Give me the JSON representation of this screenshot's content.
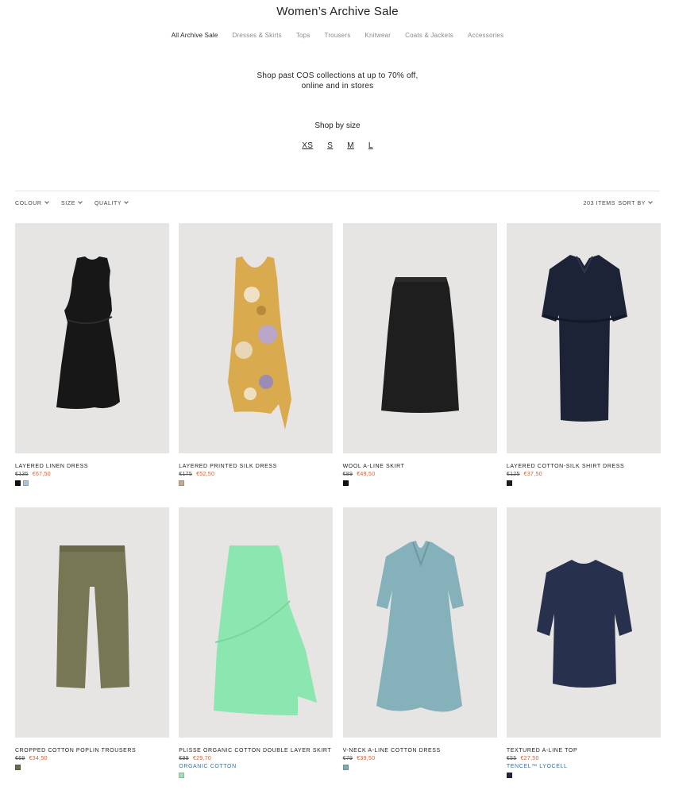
{
  "header": {
    "title": "Women’s Archive Sale"
  },
  "categories": [
    {
      "label": "All Archive Sale",
      "active": true
    },
    {
      "label": "Dresses & Skirts",
      "active": false
    },
    {
      "label": "Tops",
      "active": false
    },
    {
      "label": "Trousers",
      "active": false
    },
    {
      "label": "Knitwear",
      "active": false
    },
    {
      "label": "Coats & Jackets",
      "active": false
    },
    {
      "label": "Accessories",
      "active": false
    }
  ],
  "promo": {
    "line1": "Shop past COS collections at up to 70% off,",
    "line2": "online and in stores"
  },
  "size_section": {
    "heading": "Shop by size",
    "sizes": [
      "XS",
      "S",
      "M",
      "L"
    ]
  },
  "filters": {
    "colour": "COLOUR",
    "size": "SIZE",
    "quality": "QUALITY",
    "items": "203 ITEMS",
    "sort": "SORT BY"
  },
  "products": [
    {
      "name": "LAYERED LINEN DRESS",
      "old_price": "€135",
      "new_price": "€67,50",
      "tag": "",
      "swatches": [
        "#111111",
        "#a9c2dc"
      ],
      "garment": "black-dress"
    },
    {
      "name": "LAYERED PRINTED SILK DRESS",
      "old_price": "€175",
      "new_price": "€52,50",
      "tag": "",
      "swatches": [
        "#c9a98a"
      ],
      "garment": "printed-dress"
    },
    {
      "name": "WOOL A-LINE SKIRT",
      "old_price": "€89",
      "new_price": "€49,50",
      "tag": "",
      "swatches": [
        "#111111"
      ],
      "garment": "black-skirt"
    },
    {
      "name": "LAYERED COTTON-SILK SHIRT DRESS",
      "old_price": "€125",
      "new_price": "€37,50",
      "tag": "",
      "swatches": [
        "#1b1d24"
      ],
      "garment": "navy-shirt-dress"
    },
    {
      "name": "CROPPED COTTON POPLIN TROUSERS",
      "old_price": "€69",
      "new_price": "€34,50",
      "tag": "",
      "swatches": [
        "#6b6a4a"
      ],
      "garment": "olive-trousers"
    },
    {
      "name": "PLISSE ORGANIC COTTON DOUBLE LAYER SKIRT",
      "old_price": "€99",
      "new_price": "€29,70",
      "tag": "ORGANIC COTTON",
      "swatches": [
        "#9ee0b4"
      ],
      "garment": "mint-skirt"
    },
    {
      "name": "V-NECK A-LINE COTTON DRESS",
      "old_price": "€79",
      "new_price": "€39,50",
      "tag": "",
      "swatches": [
        "#7ea9b3"
      ],
      "garment": "blue-dress"
    },
    {
      "name": "TEXTURED A-LINE TOP",
      "old_price": "€55",
      "new_price": "€27,50",
      "tag": "TENCEL™ LYOCELL",
      "swatches": [
        "#222840"
      ],
      "garment": "navy-top"
    }
  ]
}
